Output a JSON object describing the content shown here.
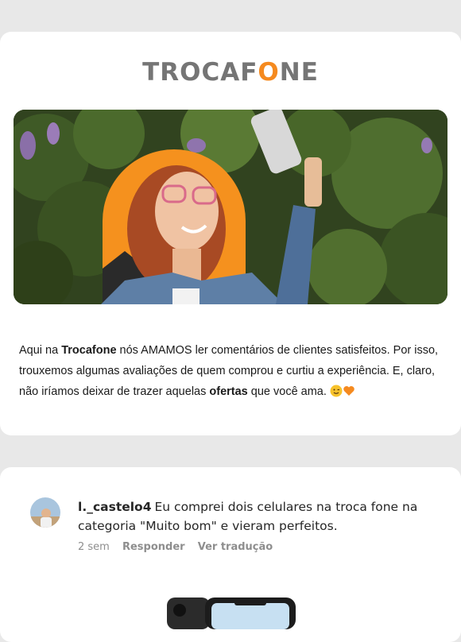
{
  "brand": {
    "logo_pre": "TROCAF",
    "logo_o": "O",
    "logo_post": "NE"
  },
  "intro": {
    "p1": "Aqui na ",
    "b1": "Trocafone",
    "p2": " nós AMAMOS ler comentários de clientes satisfeitos. Por isso, trouxemos algumas avaliações de quem comprou e curtiu a experiência. E, claro, não iríamos deixar de trazer aquelas ",
    "b2": "ofertas",
    "p3": " que você ama. "
  },
  "comment": {
    "username": "l._castelo4",
    "text": "Eu comprei dois celulares na troca fone na categoria \"Muito bom\" e vieram perfeitos.",
    "time": "2 sem",
    "reply": "Responder",
    "translate": "Ver tradução"
  },
  "colors": {
    "accent": "#f58a1f",
    "logo_gray": "#757575"
  }
}
